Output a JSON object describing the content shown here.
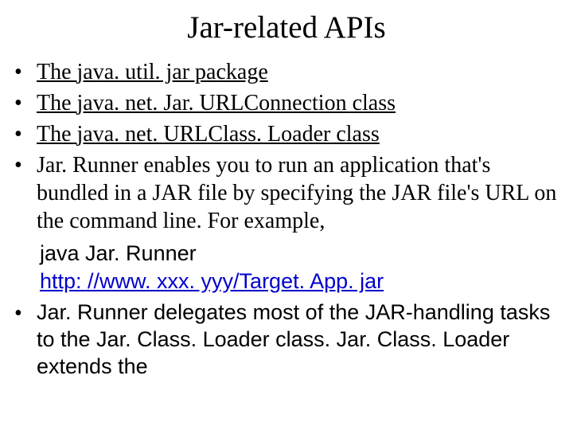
{
  "title": "Jar-related APIs",
  "bullets": {
    "b1_pre": "The ",
    "b1_mid": "java. util. jar",
    "b1_post": " package",
    "b2_pre": "The ",
    "b2_mid": "java. net. Jar. URLConnection",
    "b2_post": " class ",
    "b3_pre": "The ",
    "b3_mid": "java. net. URLClass. Loader",
    "b3_post": " class",
    "b4": "Jar. Runner enables you to run an application that's bundled in a JAR file by specifying the JAR file's URL on the command line. For example,",
    "cmd_line1": "java Jar. Runner",
    "cmd_link": "http: //www. xxx. yyy/Target. App. jar",
    "b5": "Jar. Runner delegates most of the JAR-handling tasks to the Jar. Class. Loader class. Jar. Class. Loader extends the"
  }
}
